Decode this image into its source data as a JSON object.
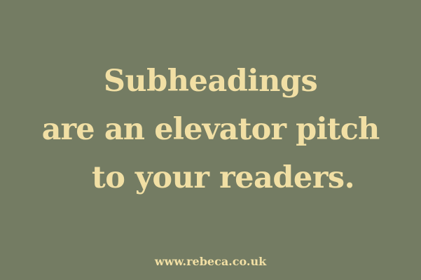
{
  "quote": {
    "lines": [
      "Subheadings",
      "are an elevator pitch",
      "to your readers."
    ]
  },
  "footer": {
    "url": "www.rebeca.co.uk"
  },
  "colors": {
    "background": "#747c63",
    "text": "#f1dfa4"
  }
}
